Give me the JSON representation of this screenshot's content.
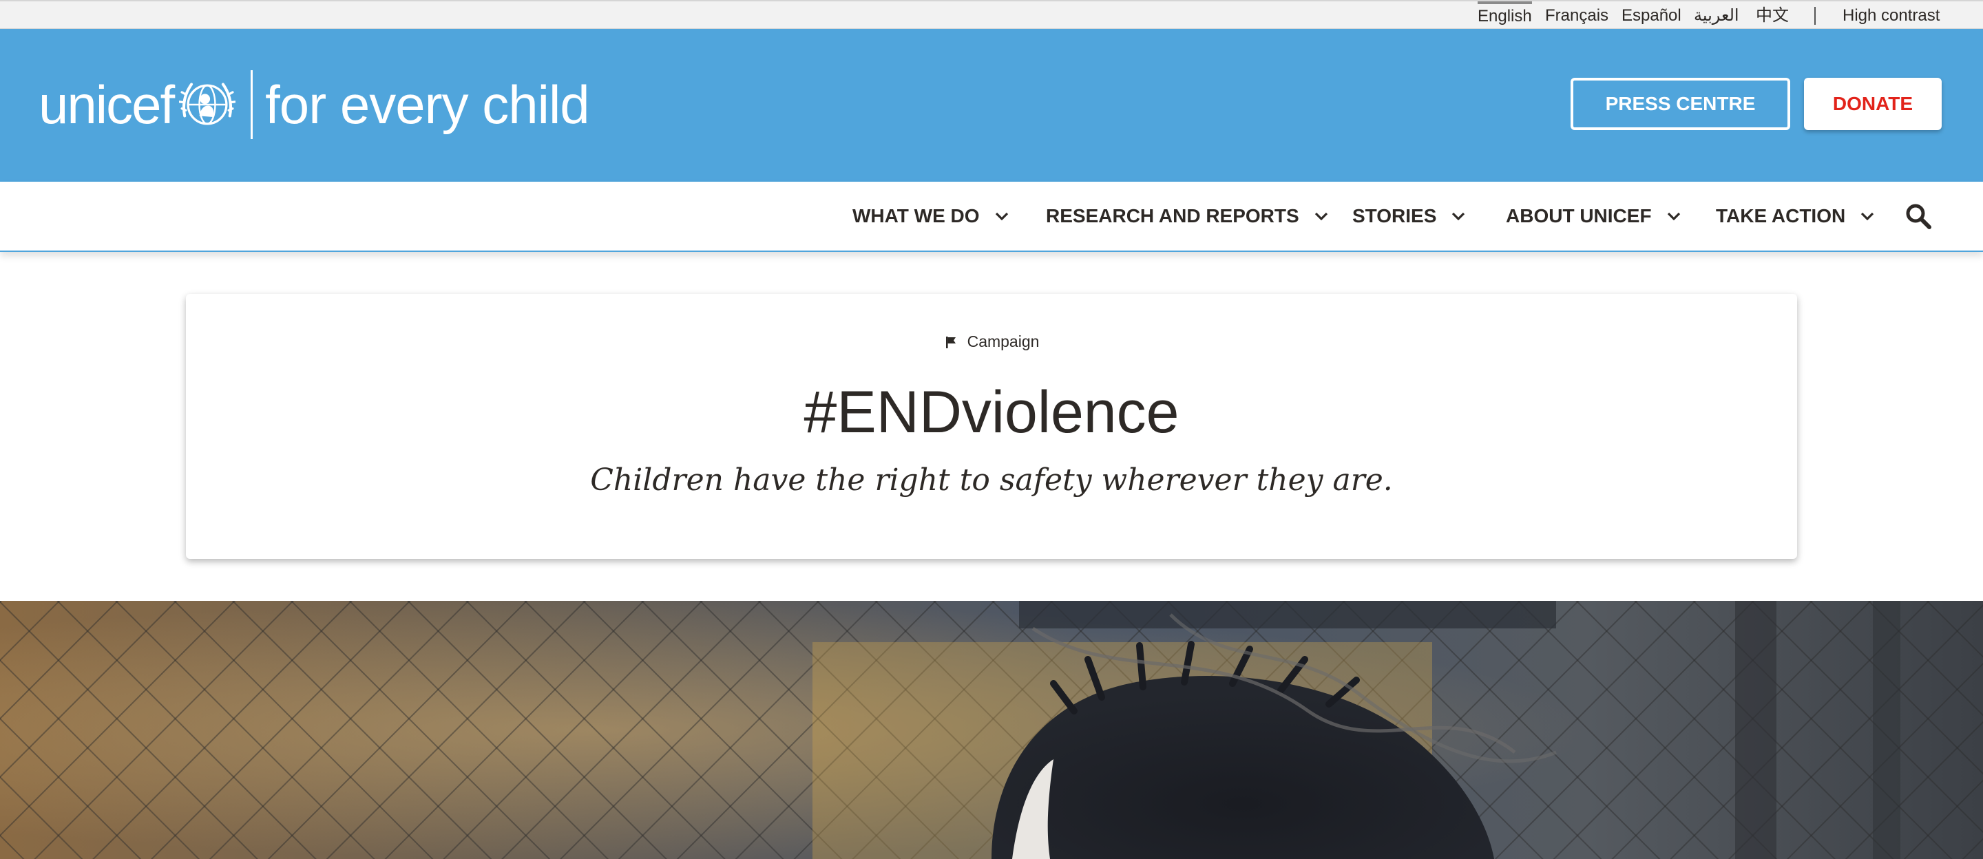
{
  "language_bar": {
    "languages": [
      {
        "label": "English",
        "active": true
      },
      {
        "label": "Français",
        "active": false
      },
      {
        "label": "Español",
        "active": false
      },
      {
        "label": "العربية",
        "active": false
      },
      {
        "label": "中文",
        "active": false
      }
    ],
    "high_contrast_label": "High contrast"
  },
  "header": {
    "logo_wordmark": "unicef",
    "logo_tagline": "for every child",
    "press_centre_label": "PRESS CENTRE",
    "donate_label": "DONATE",
    "brand_color": "#50a5dc",
    "donate_color": "#e2231a"
  },
  "nav": {
    "items": [
      {
        "label": "WHAT WE DO"
      },
      {
        "label": "RESEARCH AND REPORTS"
      },
      {
        "label": "STORIES"
      },
      {
        "label": "ABOUT UNICEF"
      },
      {
        "label": "TAKE ACTION"
      }
    ],
    "search_icon": "search-icon"
  },
  "campaign": {
    "type_label": "Campaign",
    "type_icon": "flag-icon",
    "title": "#ENDviolence",
    "subtitle": "Children have the right to safety wherever they are."
  }
}
